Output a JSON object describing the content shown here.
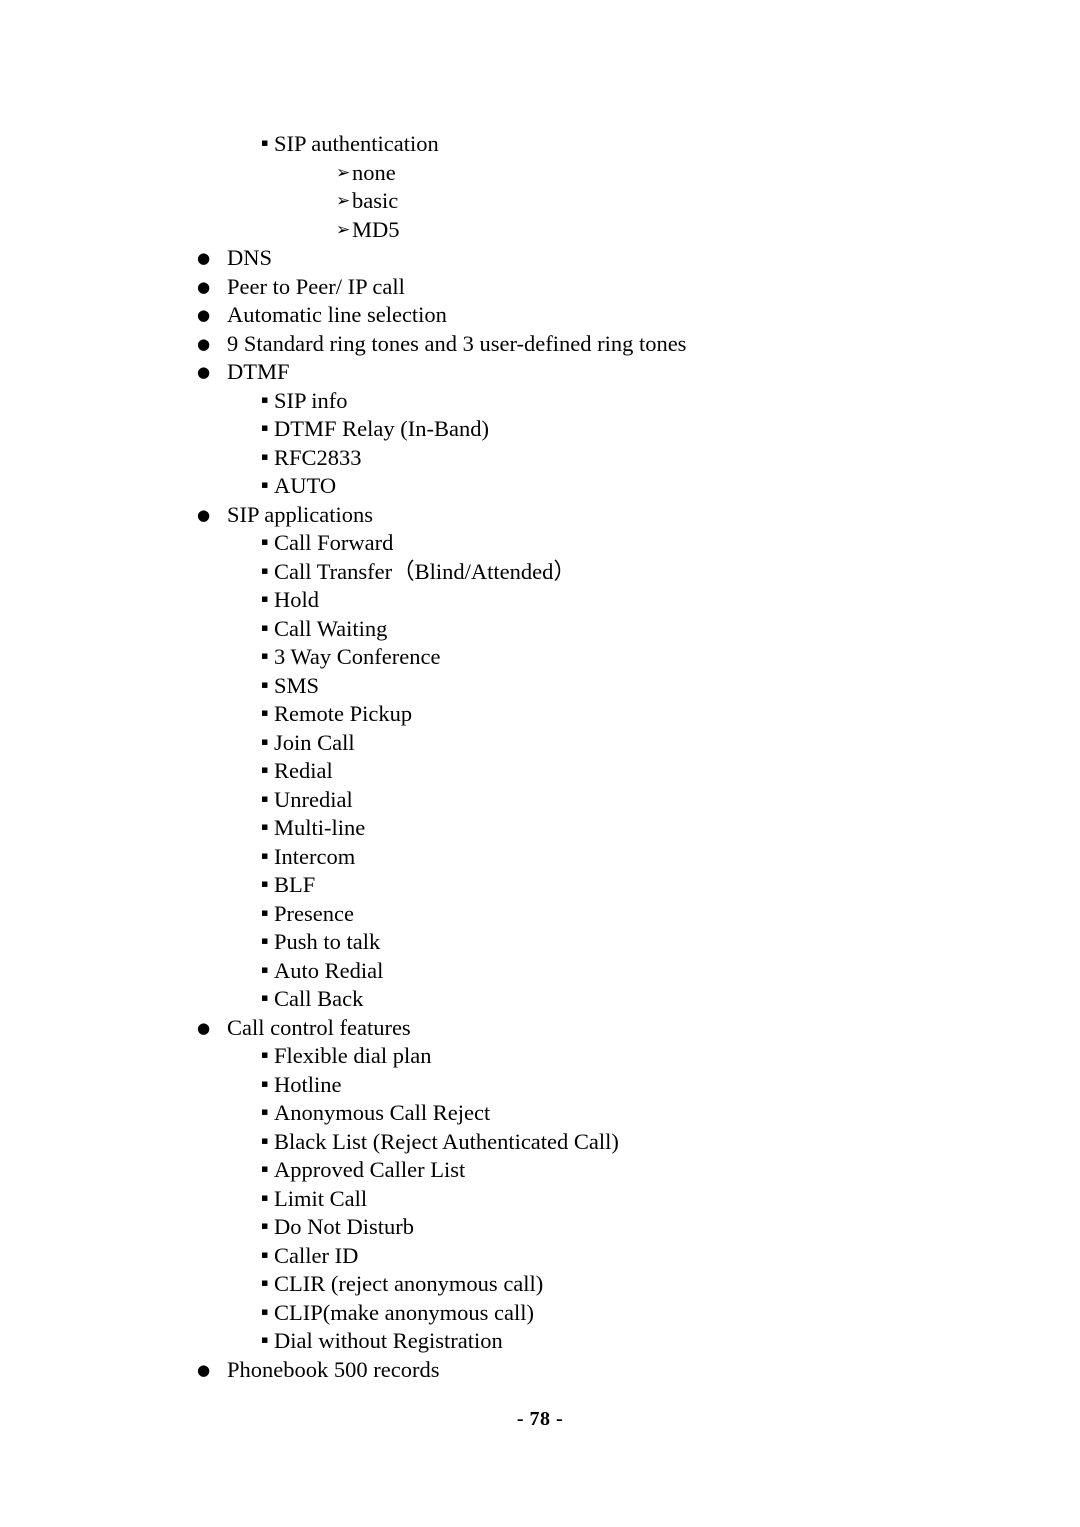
{
  "page": {
    "footer_label": "- 78 -",
    "page_number": 78,
    "text_color": "#000000",
    "background_color": "#ffffff"
  },
  "markers": {
    "level1": "●",
    "level2": "▪",
    "level3": "➢"
  },
  "outline": [
    {
      "level": 2,
      "text": "SIP authentication"
    },
    {
      "level": 3,
      "text": "none"
    },
    {
      "level": 3,
      "text": "basic"
    },
    {
      "level": 3,
      "text": "MD5"
    },
    {
      "level": 1,
      "text": "DNS"
    },
    {
      "level": 1,
      "text": "Peer to Peer/ IP call"
    },
    {
      "level": 1,
      "text": "Automatic line selection"
    },
    {
      "level": 1,
      "text": "9 Standard ring tones and 3 user-defined ring tones"
    },
    {
      "level": 1,
      "text": "DTMF"
    },
    {
      "level": 2,
      "text": "SIP info"
    },
    {
      "level": 2,
      "text": "DTMF Relay (In-Band)"
    },
    {
      "level": 2,
      "text": "RFC2833"
    },
    {
      "level": 2,
      "text": "AUTO"
    },
    {
      "level": 1,
      "text": "SIP applications"
    },
    {
      "level": 2,
      "text": "Call Forward"
    },
    {
      "level": 2,
      "text": "Call Transfer（Blind/Attended）"
    },
    {
      "level": 2,
      "text": "Hold"
    },
    {
      "level": 2,
      "text": "Call Waiting"
    },
    {
      "level": 2,
      "text": "3 Way Conference"
    },
    {
      "level": 2,
      "text": "SMS"
    },
    {
      "level": 2,
      "text": "Remote Pickup"
    },
    {
      "level": 2,
      "text": "Join Call"
    },
    {
      "level": 2,
      "text": "Redial"
    },
    {
      "level": 2,
      "text": "Unredial"
    },
    {
      "level": 2,
      "text": "Multi-line"
    },
    {
      "level": 2,
      "text": "Intercom"
    },
    {
      "level": 2,
      "text": "BLF"
    },
    {
      "level": 2,
      "text": "Presence"
    },
    {
      "level": 2,
      "text": "Push to talk"
    },
    {
      "level": 2,
      "text": "Auto Redial"
    },
    {
      "level": 2,
      "text": "Call Back"
    },
    {
      "level": 1,
      "text": "Call control features"
    },
    {
      "level": 2,
      "text": "Flexible dial plan"
    },
    {
      "level": 2,
      "text": "Hotline"
    },
    {
      "level": 2,
      "text": "Anonymous Call Reject"
    },
    {
      "level": 2,
      "text": "Black List (Reject Authenticated Call)"
    },
    {
      "level": 2,
      "text": "Approved Caller List"
    },
    {
      "level": 2,
      "text": "Limit Call"
    },
    {
      "level": 2,
      "text": "Do Not Disturb"
    },
    {
      "level": 2,
      "text": "Caller ID"
    },
    {
      "level": 2,
      "text": "CLIR (reject anonymous call)"
    },
    {
      "level": 2,
      "text": "CLIP(make anonymous call)"
    },
    {
      "level": 2,
      "text": "Dial without Registration"
    },
    {
      "level": 1,
      "text": "Phonebook 500 records"
    }
  ]
}
